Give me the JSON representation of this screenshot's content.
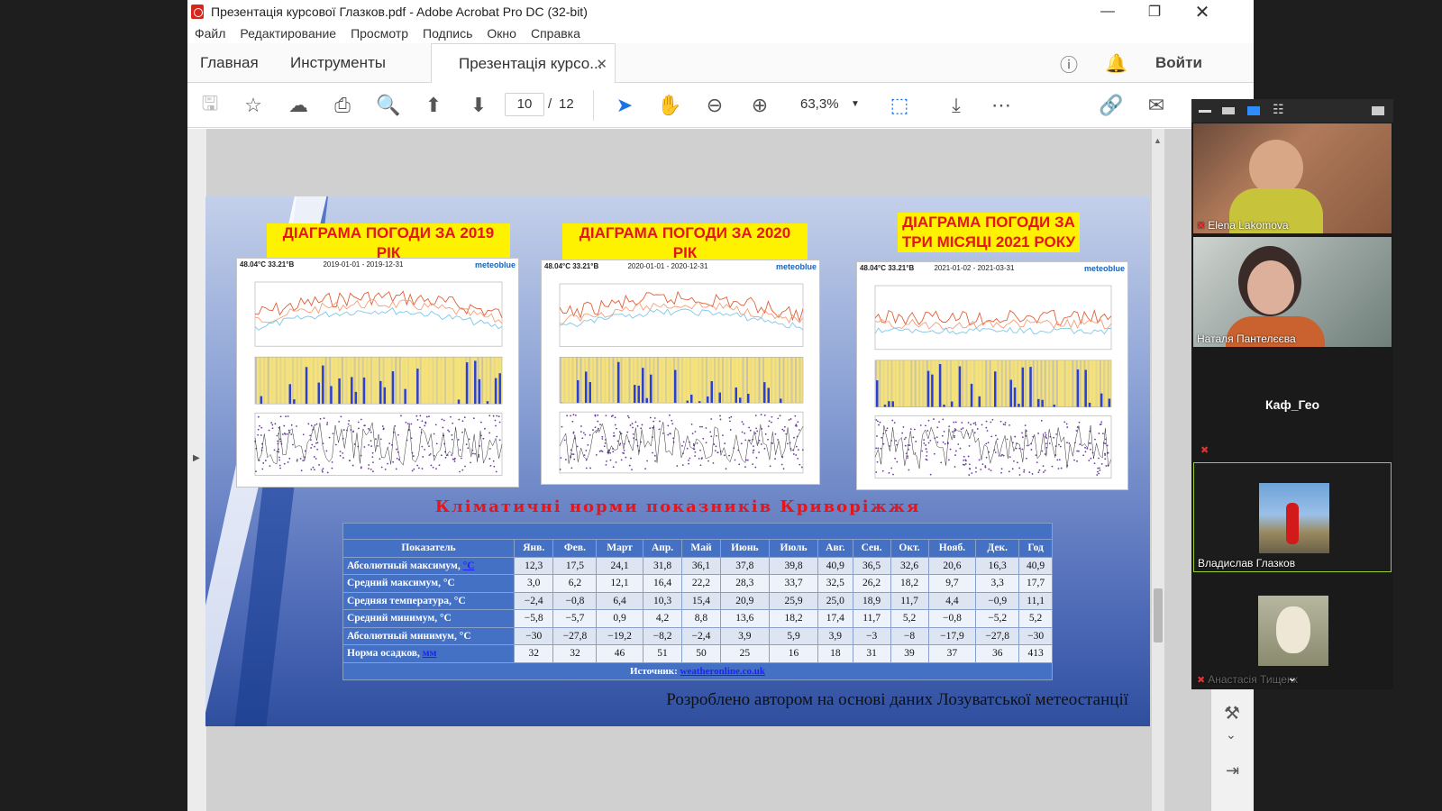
{
  "window": {
    "title": "Презентація курсової Глазков.pdf - Adobe Acrobat Pro DC (32-bit)"
  },
  "menu": [
    "Файл",
    "Редактирование",
    "Просмотр",
    "Подпись",
    "Окно",
    "Справка"
  ],
  "tabs": {
    "home": "Главная",
    "tools": "Инструменты",
    "doc": "Презентація курсо...",
    "signin": "Войти"
  },
  "toolbar": {
    "page_current": "10",
    "page_sep": "/",
    "page_total": "12",
    "zoom": "63,3%"
  },
  "slide": {
    "titles": [
      "ДІАГРАМА ПОГОДИ ЗА 2019 РІК",
      "ДІАГРАМА ПОГОДИ ЗА 2020 РІК",
      "ДІАГРАМА ПОГОДИ ЗА ТРИ МІСЯЦІ 2021 РОКУ"
    ],
    "cards": [
      {
        "coords": "48.04°С 33.21°В",
        "brand": "meteoblue",
        "period": "2019-01-01 - 2019-12-31"
      },
      {
        "coords": "48.04°С 33.21°В",
        "brand": "meteoblue",
        "period": "2020-01-01 - 2020-12-31"
      },
      {
        "coords": "48.04°С 33.21°В",
        "brand": "meteoblue",
        "period": "2021-01-02 - 2021-03-31"
      }
    ],
    "climate_title": "Кліматичні норми показників Криворіжжя",
    "table": {
      "headers": [
        "Показатель",
        "Янв.",
        "Фев.",
        "Март",
        "Апр.",
        "Май",
        "Июнь",
        "Июль",
        "Авг.",
        "Сен.",
        "Окт.",
        "Нояб.",
        "Дек.",
        "Год"
      ],
      "rows": [
        {
          "label": "Абсолютный максимум, ",
          "unit": "°C",
          "values": [
            "12,3",
            "17,5",
            "24,1",
            "31,8",
            "36,1",
            "37,8",
            "39,8",
            "40,9",
            "36,5",
            "32,6",
            "20,6",
            "16,3",
            "40,9"
          ]
        },
        {
          "label": "Средний максимум, °C",
          "values": [
            "3,0",
            "6,2",
            "12,1",
            "16,4",
            "22,2",
            "28,3",
            "33,7",
            "32,5",
            "26,2",
            "18,2",
            "9,7",
            "3,3",
            "17,7"
          ]
        },
        {
          "label": "Средняя температура, °C",
          "values": [
            "−2,4",
            "−0,8",
            "6,4",
            "10,3",
            "15,4",
            "20,9",
            "25,9",
            "25,0",
            "18,9",
            "11,7",
            "4,4",
            "−0,9",
            "11,1"
          ]
        },
        {
          "label": "Средний минимум, °C",
          "values": [
            "−5,8",
            "−5,7",
            "0,9",
            "4,2",
            "8,8",
            "13,6",
            "18,2",
            "17,4",
            "11,7",
            "5,2",
            "−0,8",
            "−5,2",
            "5,2"
          ]
        },
        {
          "label": "Абсолютный минимум, °C",
          "values": [
            "−30",
            "−27,8",
            "−19,2",
            "−8,2",
            "−2,4",
            "3,9",
            "5,9",
            "3,9",
            "−3",
            "−8",
            "−17,9",
            "−27,8",
            "−30"
          ]
        },
        {
          "label": "Норма осадков, ",
          "unit": "мм",
          "values": [
            "32",
            "32",
            "46",
            "51",
            "50",
            "25",
            "16",
            "18",
            "31",
            "39",
            "37",
            "36",
            "413"
          ]
        }
      ],
      "source_label": "Источник: ",
      "source_link": "weatheronline.co.uk"
    },
    "footer": "Розроблено автором на основі даних Лозуватської метеостанції"
  },
  "zoom": {
    "participants": [
      {
        "name": "Elena Lakomova"
      },
      {
        "name": "Наталя Пантелєєва"
      },
      {
        "name": "Каф_Гео"
      },
      {
        "name": "Владислав Глазков"
      },
      {
        "name": "Анастасія Тищенк"
      }
    ]
  }
}
